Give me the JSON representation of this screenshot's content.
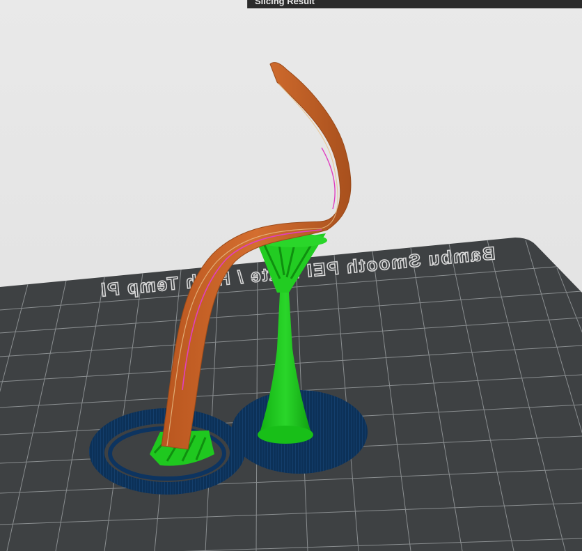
{
  "app": {
    "panel_title": "Slicing Result"
  },
  "build_plate": {
    "label": "Bambu Smooth PEI Plate / High Temp Pl"
  },
  "colors": {
    "background": "#e6e6e6",
    "plate": "#3e4143",
    "grid": "#8a8e90",
    "model_wall": "#c8642a",
    "support": "#19c819",
    "brim": "#0d3460",
    "seam": "#e040c0"
  }
}
